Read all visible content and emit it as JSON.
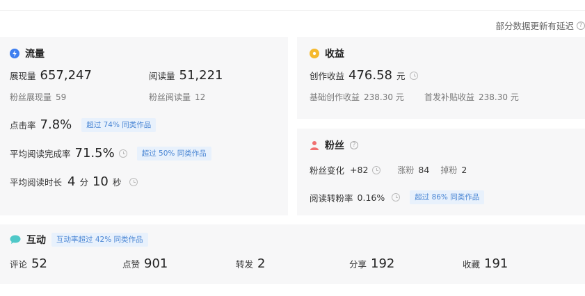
{
  "notice": "部分数据更新有延迟",
  "traffic": {
    "title": "流量",
    "impressions_label": "展现量",
    "impressions_value": "657,247",
    "reads_label": "阅读量",
    "reads_value": "51,221",
    "fan_impressions_label": "粉丝展现量",
    "fan_impressions_value": "59",
    "fan_reads_label": "粉丝阅读量",
    "fan_reads_value": "12",
    "ctr_label": "点击率",
    "ctr_value": "7.8%",
    "ctr_badge": "超过 74% 同类作品",
    "completion_label": "平均阅读完成率",
    "completion_value": "71.5%",
    "completion_badge": "超过 50% 同类作品",
    "duration_label": "平均阅读时长",
    "duration_min": "4",
    "duration_min_unit": "分",
    "duration_sec": "10",
    "duration_sec_unit": "秒"
  },
  "revenue": {
    "title": "收益",
    "creation_label": "创作收益",
    "creation_value": "476.58",
    "creation_unit": "元",
    "base_label": "基础创作收益",
    "base_value": "238.30 元",
    "first_label": "首发补贴收益",
    "first_value": "238.30 元"
  },
  "fans": {
    "title": "粉丝",
    "change_label": "粉丝变化",
    "change_value": "+82",
    "gain_label": "涨粉",
    "gain_value": "84",
    "loss_label": "掉粉",
    "loss_value": "2",
    "conv_label": "阅读转粉率",
    "conv_value": "0.16%",
    "conv_badge": "超过 86% 同类作品"
  },
  "interaction": {
    "title": "互动",
    "badge": "互动率超过 42% 同类作品",
    "items": [
      {
        "label": "评论",
        "value": "52"
      },
      {
        "label": "点赞",
        "value": "901"
      },
      {
        "label": "转发",
        "value": "2"
      },
      {
        "label": "分享",
        "value": "192"
      },
      {
        "label": "收藏",
        "value": "191"
      }
    ]
  },
  "colors": {
    "traffic_icon": "#3d7ef0",
    "revenue_icon": "#f5b92e",
    "fans_icon": "#f07070",
    "interaction_icon": "#4fc8c8",
    "badge_bg": "#e8f1fc",
    "badge_text": "#4a86d4"
  },
  "icons": {
    "traffic": "lightning-icon",
    "revenue": "coin-icon",
    "fans": "person-icon",
    "interaction": "chat-bubble-icon",
    "help": "question-icon",
    "history": "clock-icon"
  }
}
